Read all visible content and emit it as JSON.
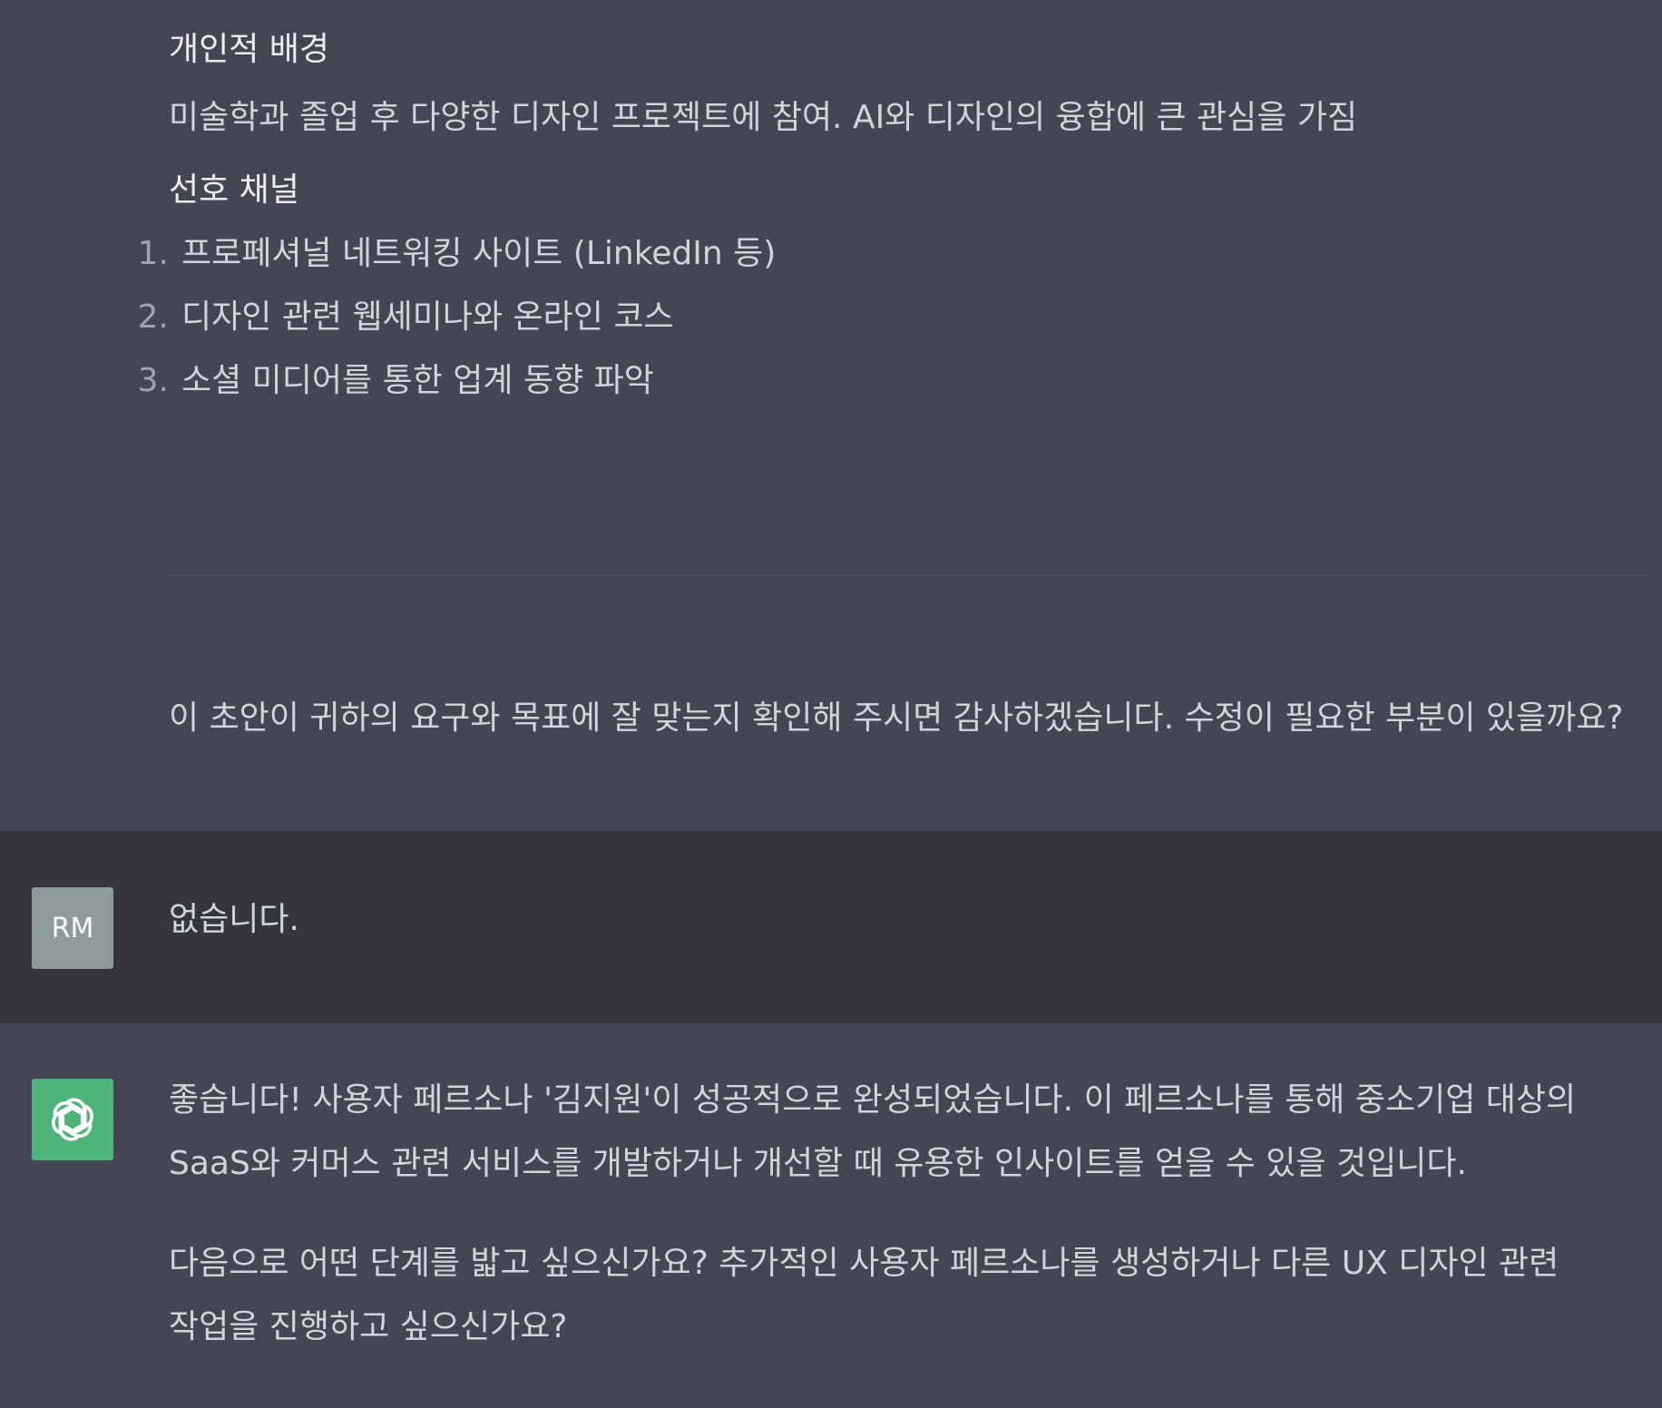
{
  "top_assistant": {
    "background_heading": "개인적 배경",
    "background_text": "미술학과 졸업 후 다양한 디자인 프로젝트에 참여. AI와 디자인의 융합에 큰 관심을 가짐",
    "channels_heading": "선호 채널",
    "channels": [
      {
        "num": "1.",
        "text": "프로페셔널 네트워킹 사이트 (LinkedIn 등)"
      },
      {
        "num": "2.",
        "text": "디자인 관련 웹세미나와 온라인 코스"
      },
      {
        "num": "3.",
        "text": "소셜 미디어를 통한 업계 동향 파악"
      }
    ],
    "closing": "이 초안이 귀하의 요구와 목표에 잘 맞는지 확인해 주시면 감사하겠습니다. 수정이 필요한 부분이 있을까요?"
  },
  "user_message": {
    "avatar_initials": "RM",
    "text": "없습니다."
  },
  "final_assistant": {
    "avatar_icon": "openai-logo-icon",
    "para1": "좋습니다! 사용자 페르소나 '김지원'이 성공적으로 완성되었습니다. 이 페르소나를 통해 중소기업 대상의 SaaS와 커머스 관련 서비스를 개발하거나 개선할 때 유용한 인사이트를 얻을 수 있을 것입니다.",
    "para2": "다음으로 어떤 단계를 밟고 싶으신가요? 추가적인 사용자 페르소나를 생성하거나 다른 UX 디자인 관련 작업을 진행하고 싶으신가요?"
  },
  "colors": {
    "assistant_bg": "#444654",
    "user_bg": "#343541",
    "user_avatar": "#8e9a9b",
    "gpt_avatar": "#4db47a"
  }
}
